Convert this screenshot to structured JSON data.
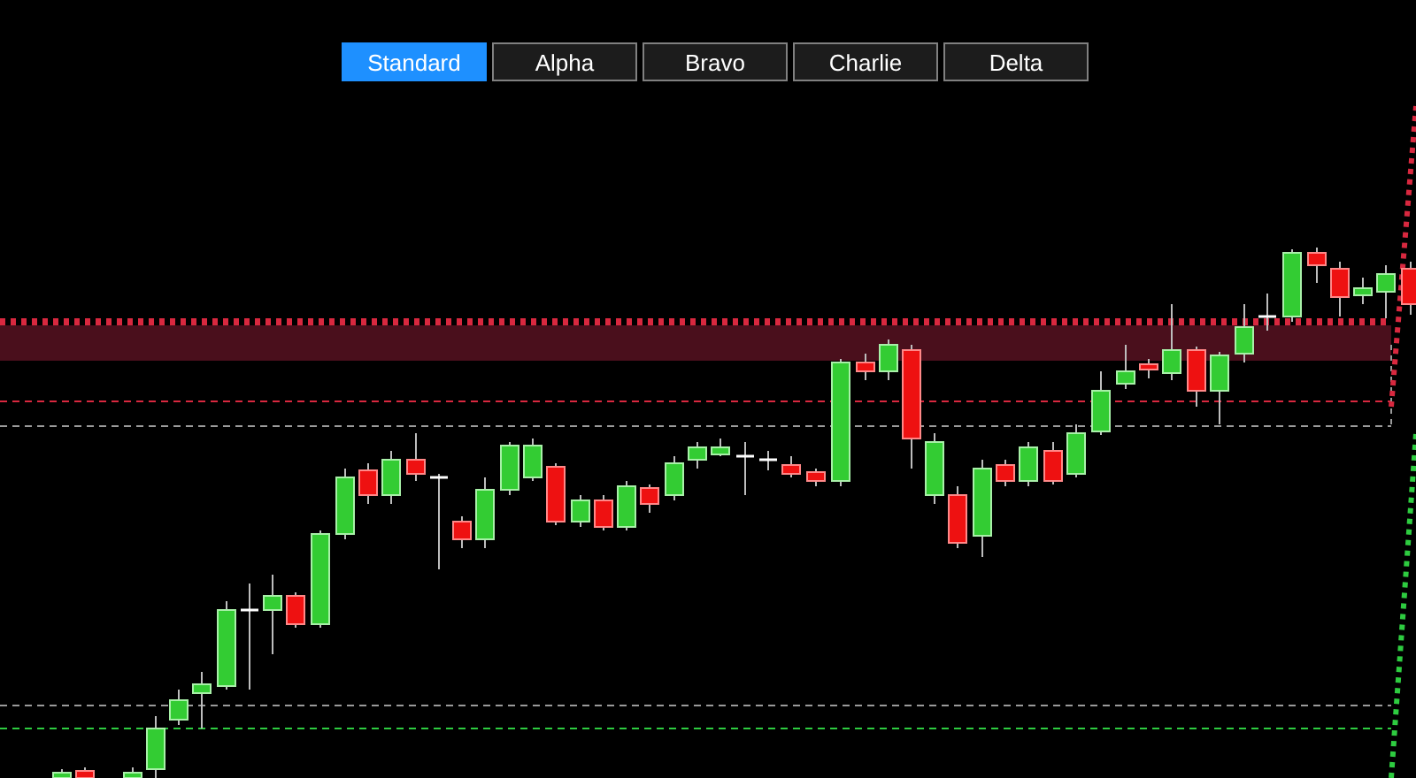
{
  "tabs": [
    {
      "label": "Standard",
      "selected": true
    },
    {
      "label": "Alpha",
      "selected": false
    },
    {
      "label": "Bravo",
      "selected": false
    },
    {
      "label": "Charlie",
      "selected": false
    },
    {
      "label": "Delta",
      "selected": false
    }
  ]
}
